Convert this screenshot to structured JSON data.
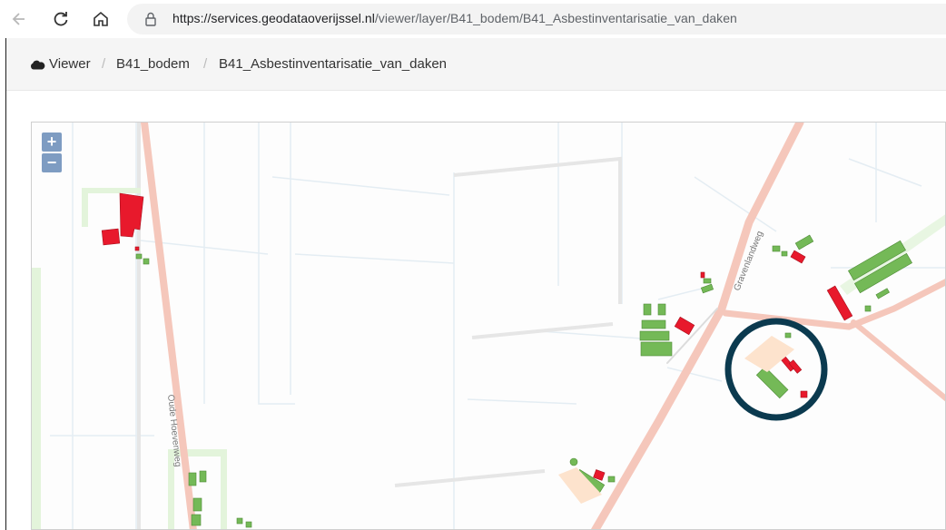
{
  "browser": {
    "url_host": "https://services.geodataoverijssel.nl",
    "url_path": "/viewer/layer/B41_bodem/B41_Asbestinventarisatie_van_daken",
    "icons": [
      "back-arrow-icon",
      "reload-icon",
      "home-icon",
      "lock-icon"
    ]
  },
  "breadcrumb": {
    "items": [
      "Viewer",
      "B41_bodem",
      "B41_Asbestinventarisatie_van_daken"
    ],
    "separator": "/"
  },
  "map": {
    "zoom_in": "+",
    "zoom_out": "−",
    "road_labels": [
      "Gravenlandweg",
      "Oude Hoevenweg"
    ],
    "colors": {
      "road": "#f4c4b8",
      "asbestos_roof": "#e8192c",
      "no_asbestos_roof": "#72b755",
      "parcel_line": "#e6eef4",
      "highlight_ring": "#0b3a4f"
    }
  }
}
